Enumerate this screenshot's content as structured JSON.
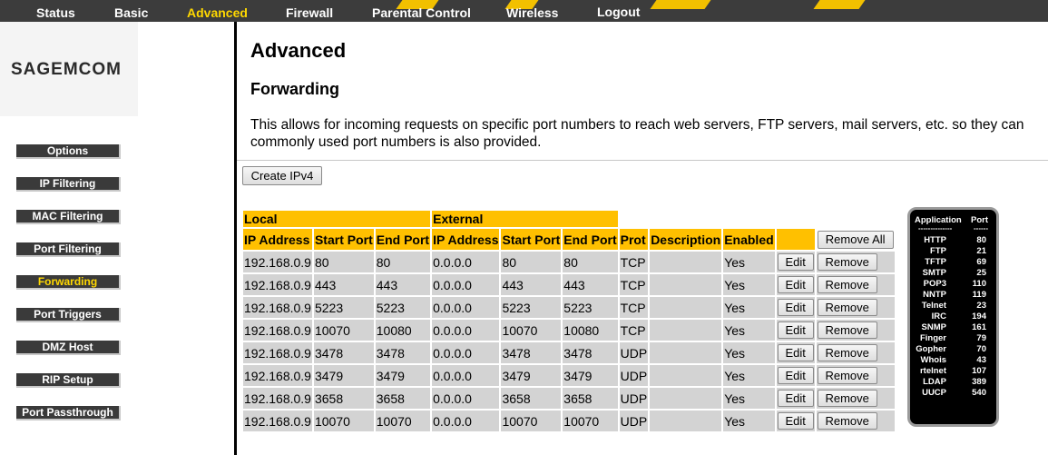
{
  "topnav": {
    "items": [
      {
        "label": "Status"
      },
      {
        "label": "Basic"
      },
      {
        "label": "Advanced",
        "active": true
      },
      {
        "label": "Firewall"
      },
      {
        "label": "Parental Control"
      },
      {
        "label": "Wireless"
      },
      {
        "label": "Logout"
      }
    ]
  },
  "brand": {
    "logo_text": "SAGEMCOM"
  },
  "sidebar": {
    "items": [
      {
        "label": "Options"
      },
      {
        "label": "IP Filtering"
      },
      {
        "label": "MAC Filtering"
      },
      {
        "label": "Port Filtering"
      },
      {
        "label": "Forwarding",
        "active": true
      },
      {
        "label": "Port Triggers"
      },
      {
        "label": "DMZ Host"
      },
      {
        "label": "RIP Setup"
      },
      {
        "label": "Port Passthrough"
      }
    ]
  },
  "main": {
    "title": "Advanced",
    "section_title": "Forwarding",
    "description_line1": "This allows for incoming requests on specific port numbers to reach web servers, FTP servers, mail servers, etc. so they can",
    "description_line2": "commonly used port numbers is also provided.",
    "create_button": "Create IPv4"
  },
  "table": {
    "group_local": "Local",
    "group_external": "External",
    "headers": {
      "local_ip": "IP Address",
      "local_start": "Start Port",
      "local_end": "End Port",
      "ext_ip": "IP Address",
      "ext_start": "Start Port",
      "ext_end": "End Port",
      "prot": "Prot",
      "description": "Description",
      "enabled": "Enabled"
    },
    "remove_all_label": "Remove All",
    "edit_label": "Edit",
    "remove_label": "Remove",
    "rows": [
      {
        "local_ip": "192.168.0.9",
        "local_start": "80",
        "local_end": "80",
        "ext_ip": "0.0.0.0",
        "ext_start": "80",
        "ext_end": "80",
        "prot": "TCP",
        "description": "",
        "enabled": "Yes"
      },
      {
        "local_ip": "192.168.0.9",
        "local_start": "443",
        "local_end": "443",
        "ext_ip": "0.0.0.0",
        "ext_start": "443",
        "ext_end": "443",
        "prot": "TCP",
        "description": "",
        "enabled": "Yes"
      },
      {
        "local_ip": "192.168.0.9",
        "local_start": "5223",
        "local_end": "5223",
        "ext_ip": "0.0.0.0",
        "ext_start": "5223",
        "ext_end": "5223",
        "prot": "TCP",
        "description": "",
        "enabled": "Yes"
      },
      {
        "local_ip": "192.168.0.9",
        "local_start": "10070",
        "local_end": "10080",
        "ext_ip": "0.0.0.0",
        "ext_start": "10070",
        "ext_end": "10080",
        "prot": "TCP",
        "description": "",
        "enabled": "Yes"
      },
      {
        "local_ip": "192.168.0.9",
        "local_start": "3478",
        "local_end": "3478",
        "ext_ip": "0.0.0.0",
        "ext_start": "3478",
        "ext_end": "3478",
        "prot": "UDP",
        "description": "",
        "enabled": "Yes"
      },
      {
        "local_ip": "192.168.0.9",
        "local_start": "3479",
        "local_end": "3479",
        "ext_ip": "0.0.0.0",
        "ext_start": "3479",
        "ext_end": "3479",
        "prot": "UDP",
        "description": "",
        "enabled": "Yes"
      },
      {
        "local_ip": "192.168.0.9",
        "local_start": "3658",
        "local_end": "3658",
        "ext_ip": "0.0.0.0",
        "ext_start": "3658",
        "ext_end": "3658",
        "prot": "UDP",
        "description": "",
        "enabled": "Yes"
      },
      {
        "local_ip": "192.168.0.9",
        "local_start": "10070",
        "local_end": "10070",
        "ext_ip": "0.0.0.0",
        "ext_start": "10070",
        "ext_end": "10070",
        "prot": "UDP",
        "description": "",
        "enabled": "Yes"
      }
    ]
  },
  "port_reference": {
    "header_app": "Application",
    "header_port": "Port",
    "dash_app": "--------------",
    "dash_port": "------",
    "entries": [
      {
        "app": "HTTP",
        "port": "80"
      },
      {
        "app": "FTP",
        "port": "21"
      },
      {
        "app": "TFTP",
        "port": "69"
      },
      {
        "app": "SMTP",
        "port": "25"
      },
      {
        "app": "POP3",
        "port": "110"
      },
      {
        "app": "NNTP",
        "port": "119"
      },
      {
        "app": "Telnet",
        "port": "23"
      },
      {
        "app": "IRC",
        "port": "194"
      },
      {
        "app": "SNMP",
        "port": "161"
      },
      {
        "app": "Finger",
        "port": "79"
      },
      {
        "app": "Gopher",
        "port": "70"
      },
      {
        "app": "Whois",
        "port": "43"
      },
      {
        "app": "rtelnet",
        "port": "107"
      },
      {
        "app": "LDAP",
        "port": "389"
      },
      {
        "app": "UUCP",
        "port": "540"
      }
    ]
  },
  "colors": {
    "nav_bg": "#3c3c3c",
    "accent_yellow": "#ffc000",
    "active_text": "#ffd800",
    "cell_gray": "#d3d3d3"
  }
}
